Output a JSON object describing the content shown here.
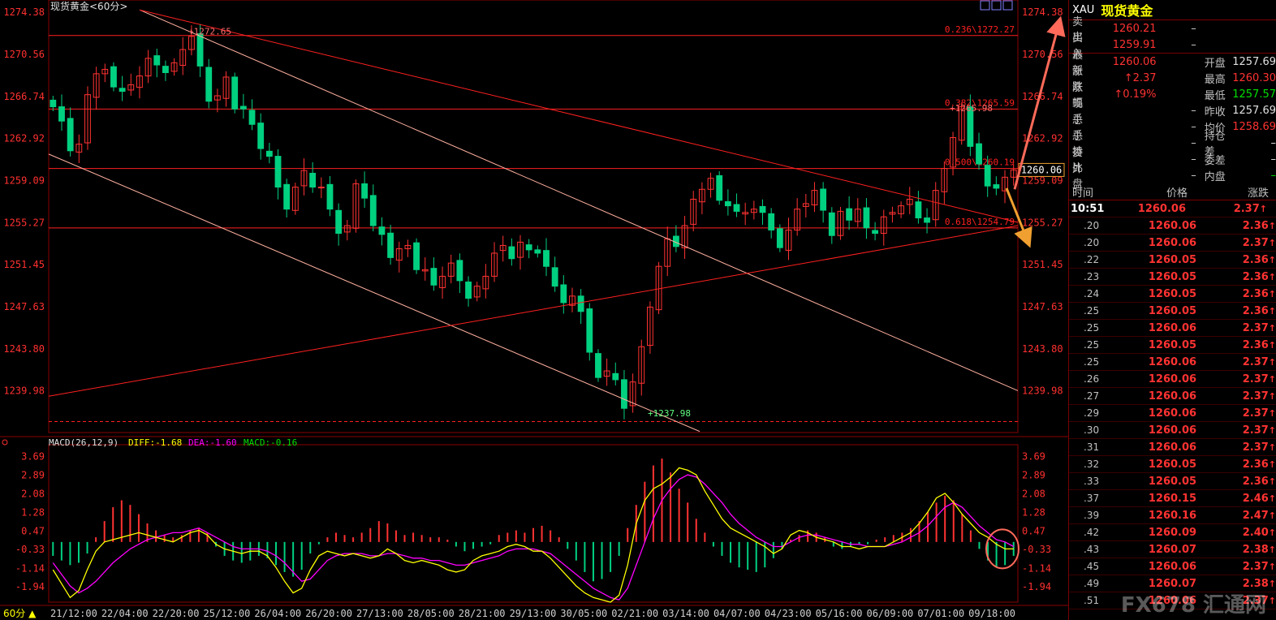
{
  "header": {
    "title": "现货黄金<60分>",
    "macd_label": "MACD(26,12,9)",
    "diff_label": "DIFF:-1.68",
    "dea_label": "DEA:-1.60",
    "macd_value_label": "MACD:-0.16",
    "period_label": "60分"
  },
  "colors": {
    "up": "#ff3232",
    "down": "#00d080",
    "diff": "#ffff00",
    "dea": "#ff00ff",
    "grid": "#8b0000",
    "fib": "#ff2020",
    "arrow_up": "#ff6a5a",
    "arrow_down": "#f0a030"
  },
  "chart_data": {
    "type": "candlestick",
    "price_axis_labels": [
      "1274.38",
      "1270.56",
      "1266.74",
      "1262.92",
      "1259.09",
      "1255.27",
      "1251.45",
      "1247.63",
      "1243.80",
      "1239.98"
    ],
    "price_axis_values": [
      1274.38,
      1270.56,
      1266.74,
      1262.92,
      1259.09,
      1255.27,
      1251.45,
      1247.63,
      1243.8,
      1239.98
    ],
    "ylim": [
      1236.2,
      1275.5
    ],
    "current_price_label": "1260.06",
    "current_price": 1260.06,
    "high_label": "1272.65",
    "high_value": 1272.65,
    "low_label": "1237.98",
    "low_value": 1237.98,
    "local_high_label": "1265.98",
    "fib_levels": [
      {
        "label": "0.236\\1272.27",
        "value": 1272.27
      },
      {
        "label": "0.382\\1265.59",
        "value": 1265.59
      },
      {
        "label": "0.500\\1260.19",
        "value": 1260.19
      },
      {
        "label": "0.618\\1254.79",
        "value": 1254.79
      }
    ],
    "time_labels": [
      "21/12:00",
      "22/04:00",
      "22/20:00",
      "25/12:00",
      "26/04:00",
      "26/20:00",
      "27/13:00",
      "28/05:00",
      "28/21:00",
      "29/13:00",
      "30/05:00",
      "02/21:00",
      "03/14:00",
      "04/07:00",
      "04/23:00",
      "05/16:00",
      "06/09:00",
      "07/01:00",
      "09/18:00"
    ],
    "close_path": [
      1265.8,
      1264.5,
      1261.8,
      1262.4,
      1266.9,
      1268.8,
      1269.2,
      1267.6,
      1267.2,
      1267.8,
      1268.6,
      1270.2,
      1269.6,
      1268.9,
      1269.8,
      1271.0,
      1272.2,
      1269.5,
      1266.3,
      1266.8,
      1268.5,
      1265.6,
      1265.6,
      1264.2,
      1262.0,
      1261.3,
      1258.5,
      1256.5,
      1258.5,
      1260.0,
      1258.5,
      1258.5,
      1256.5,
      1254.3,
      1255.0,
      1258.8,
      1257.5,
      1255.0,
      1254.2,
      1252.1,
      1252.9,
      1253.2,
      1251.0,
      1251.0,
      1249.6,
      1250.4,
      1251.6,
      1250.0,
      1248.4,
      1249.5,
      1250.4,
      1252.5,
      1253.2,
      1252.0,
      1253.5,
      1252.8,
      1252.5,
      1251.3,
      1249.5,
      1248.0,
      1248.6,
      1247.2,
      1243.5,
      1241.2,
      1241.8,
      1241.0,
      1238.4,
      1240.8,
      1244.0,
      1247.6,
      1251.3,
      1253.8,
      1253.1,
      1255.0,
      1257.4,
      1258.3,
      1259.3,
      1257.3,
      1256.8,
      1256.3,
      1256.2,
      1256.5,
      1256.2,
      1254.6,
      1253.0,
      1254.6,
      1256.5,
      1257.0,
      1258.2,
      1256.4,
      1254.1,
      1256.3,
      1255.5,
      1256.5,
      1254.8,
      1254.3,
      1255.8,
      1256.2,
      1256.8,
      1257.4,
      1255.7,
      1255.3,
      1258.2,
      1260.2,
      1263.0,
      1265.8,
      1262.2,
      1260.6,
      1258.6,
      1258.4,
      1259.4,
      1260.06
    ],
    "macd_axis_labels": [
      "3.69",
      "2.89",
      "2.08",
      "1.28",
      "0.47",
      "-0.33",
      "-1.14",
      "-1.94"
    ],
    "macd_axis_values": [
      3.69,
      2.89,
      2.08,
      1.28,
      0.47,
      -0.33,
      -1.14,
      -1.94
    ],
    "macd_ylim": [
      -2.6,
      4.2
    ],
    "macd_hist": [
      -0.6,
      -0.8,
      -1.0,
      -0.9,
      -0.5,
      0.2,
      0.9,
      1.5,
      1.8,
      1.6,
      1.2,
      0.8,
      0.5,
      0.3,
      0.2,
      0.3,
      0.5,
      0.6,
      0.4,
      -0.2,
      -0.6,
      -0.8,
      -0.9,
      -0.8,
      -0.6,
      -0.7,
      -1.0,
      -1.3,
      -1.5,
      -1.2,
      -0.5,
      -0.1,
      0.2,
      0.4,
      0.3,
      0.2,
      0.4,
      0.6,
      0.9,
      0.8,
      0.5,
      0.3,
      0.4,
      0.3,
      0.2,
      0.2,
      0.1,
      -0.2,
      -0.4,
      -0.3,
      -0.2,
      -0.1,
      0.3,
      0.4,
      0.5,
      0.4,
      0.6,
      0.7,
      0.5,
      0.2,
      -0.3,
      -0.8,
      -1.3,
      -1.7,
      -1.6,
      -1.3,
      -0.6,
      0.6,
      1.6,
      2.6,
      3.3,
      3.6,
      3.0,
      2.3,
      1.7,
      1.0,
      0.4,
      -0.2,
      -0.6,
      -0.9,
      -1.1,
      -1.2,
      -1.3,
      -1.1,
      -0.7,
      -0.3,
      0.1,
      0.3,
      0.5,
      0.4,
      0.2,
      -0.2,
      -0.3,
      -0.2,
      -0.1,
      -0.1,
      0.1,
      0.2,
      0.3,
      0.4,
      0.6,
      0.9,
      1.3,
      1.7,
      2.0,
      1.8,
      1.2,
      0.5,
      -0.3,
      -0.8,
      -1.1,
      -1.0,
      -0.6
    ],
    "diff_path": [
      -1.2,
      -1.8,
      -2.4,
      -2.1,
      -1.2,
      -0.4,
      0.0,
      0.1,
      0.2,
      0.3,
      0.4,
      0.3,
      0.2,
      0.1,
      0.0,
      0.2,
      0.4,
      0.5,
      0.3,
      -0.1,
      -0.3,
      -0.4,
      -0.5,
      -0.4,
      -0.4,
      -0.6,
      -1.1,
      -1.7,
      -2.2,
      -2.0,
      -1.2,
      -0.6,
      -0.4,
      -0.5,
      -0.6,
      -0.5,
      -0.6,
      -0.7,
      -0.6,
      -0.3,
      -0.5,
      -0.8,
      -0.9,
      -0.8,
      -0.9,
      -1.0,
      -1.2,
      -1.3,
      -1.2,
      -0.8,
      -0.6,
      -0.5,
      -0.4,
      -0.2,
      -0.1,
      -0.2,
      -0.4,
      -0.4,
      -0.7,
      -1.1,
      -1.5,
      -1.9,
      -2.2,
      -2.4,
      -2.5,
      -2.6,
      -2.3,
      -1.0,
      0.8,
      1.8,
      2.3,
      2.5,
      2.8,
      3.2,
      3.1,
      2.9,
      2.2,
      1.6,
      1.0,
      0.6,
      0.4,
      0.2,
      0.0,
      -0.2,
      -0.5,
      -0.3,
      0.3,
      0.5,
      0.4,
      0.2,
      0.1,
      0.0,
      -0.2,
      -0.2,
      -0.3,
      -0.2,
      -0.2,
      -0.2,
      0.0,
      0.2,
      0.4,
      0.8,
      1.3,
      1.9,
      2.1,
      1.7,
      1.2,
      0.8,
      0.4,
      0.2,
      -0.1,
      -0.3,
      -0.3
    ],
    "dea_path": [
      -0.9,
      -1.4,
      -1.9,
      -2.2,
      -2.0,
      -1.7,
      -1.3,
      -0.9,
      -0.6,
      -0.3,
      -0.1,
      0.1,
      0.2,
      0.3,
      0.4,
      0.4,
      0.5,
      0.6,
      0.4,
      0.2,
      0.0,
      -0.2,
      -0.3,
      -0.3,
      -0.3,
      -0.4,
      -0.6,
      -0.9,
      -1.3,
      -1.7,
      -1.6,
      -1.2,
      -0.8,
      -0.6,
      -0.5,
      -0.5,
      -0.5,
      -0.6,
      -0.6,
      -0.5,
      -0.5,
      -0.6,
      -0.7,
      -0.7,
      -0.8,
      -0.8,
      -0.9,
      -1.0,
      -1.0,
      -0.9,
      -0.8,
      -0.7,
      -0.6,
      -0.4,
      -0.3,
      -0.3,
      -0.3,
      -0.4,
      -0.5,
      -0.8,
      -1.1,
      -1.4,
      -1.7,
      -2.0,
      -2.2,
      -2.4,
      -2.5,
      -2.0,
      -1.0,
      0.0,
      1.0,
      1.8,
      2.3,
      2.7,
      2.9,
      2.8,
      2.5,
      2.1,
      1.7,
      1.2,
      0.8,
      0.5,
      0.2,
      0.0,
      -0.2,
      -0.2,
      0.0,
      0.2,
      0.3,
      0.3,
      0.2,
      0.1,
      0.0,
      -0.1,
      -0.1,
      -0.2,
      -0.2,
      -0.2,
      -0.1,
      0.0,
      0.2,
      0.4,
      0.7,
      1.1,
      1.5,
      1.7,
      1.5,
      1.1,
      0.7,
      0.4,
      0.1,
      0.0,
      -0.2
    ]
  },
  "side_panel": {
    "code": "XAU",
    "name": "现货黄金",
    "quote_rows": [
      {
        "label": "卖出",
        "v1": "1260.21",
        "v1_color": "red",
        "d": "–",
        "label2": "",
        "v2": "",
        "v2_color": "white"
      },
      {
        "label": "买入",
        "v1": "1259.91",
        "v1_color": "red",
        "d": "–",
        "label2": "",
        "v2": "",
        "v2_color": "white"
      },
      {
        "label": "最新",
        "v1": "1260.06",
        "v1_color": "red",
        "d": "",
        "label2": "开盘",
        "v2": "1257.69",
        "v2_color": "white"
      },
      {
        "label": "涨跌",
        "v1": "↑2.37",
        "v1_color": "red",
        "d": "",
        "label2": "最高",
        "v2": "1260.30",
        "v2_color": "red"
      },
      {
        "label": "涨幅",
        "v1": "↑0.19%",
        "v1_color": "red",
        "d": "",
        "label2": "最低",
        "v2": "1257.57",
        "v2_color": "green"
      },
      {
        "label": "现手",
        "v1": "",
        "v1_color": "white",
        "d": "–",
        "label2": "昨收",
        "v2": "1257.69",
        "v2_color": "white"
      },
      {
        "label": "总手",
        "v1": "",
        "v1_color": "white",
        "d": "–",
        "label2": "均价",
        "v2": "1258.69",
        "v2_color": "red"
      },
      {
        "label": "总持",
        "v1": "",
        "v1_color": "white",
        "d": "–",
        "label2": "持仓差",
        "v2": "–",
        "v2_color": "white"
      },
      {
        "label": "委比",
        "v1": "",
        "v1_color": "white",
        "d": "–",
        "label2": "委差",
        "v2": "–",
        "v2_color": "white"
      },
      {
        "label": "外盘",
        "v1": "",
        "v1_color": "red",
        "d": "–",
        "label2": "内盘",
        "v2": "–",
        "v2_color": "green"
      }
    ],
    "ticks_header": {
      "time": "时间",
      "price": "价格",
      "change": "涨跌"
    },
    "ticks": [
      {
        "t": "10:51",
        "p": "1260.06",
        "c": "2.37"
      },
      {
        "t": ".20",
        "p": "1260.06",
        "c": "2.36"
      },
      {
        "t": ".20",
        "p": "1260.06",
        "c": "2.37"
      },
      {
        "t": ".22",
        "p": "1260.05",
        "c": "2.36"
      },
      {
        "t": ".23",
        "p": "1260.05",
        "c": "2.36"
      },
      {
        "t": ".24",
        "p": "1260.05",
        "c": "2.36"
      },
      {
        "t": ".25",
        "p": "1260.05",
        "c": "2.36"
      },
      {
        "t": ".25",
        "p": "1260.06",
        "c": "2.37"
      },
      {
        "t": ".25",
        "p": "1260.05",
        "c": "2.36"
      },
      {
        "t": ".25",
        "p": "1260.06",
        "c": "2.37"
      },
      {
        "t": ".26",
        "p": "1260.06",
        "c": "2.37"
      },
      {
        "t": ".27",
        "p": "1260.06",
        "c": "2.37"
      },
      {
        "t": ".29",
        "p": "1260.06",
        "c": "2.37"
      },
      {
        "t": ".30",
        "p": "1260.06",
        "c": "2.37"
      },
      {
        "t": ".31",
        "p": "1260.06",
        "c": "2.37"
      },
      {
        "t": ".32",
        "p": "1260.05",
        "c": "2.36"
      },
      {
        "t": ".33",
        "p": "1260.05",
        "c": "2.36"
      },
      {
        "t": ".37",
        "p": "1260.15",
        "c": "2.46"
      },
      {
        "t": ".39",
        "p": "1260.16",
        "c": "2.47"
      },
      {
        "t": ".42",
        "p": "1260.09",
        "c": "2.40"
      },
      {
        "t": ".43",
        "p": "1260.07",
        "c": "2.38"
      },
      {
        "t": ".45",
        "p": "1260.06",
        "c": "2.37"
      },
      {
        "t": ".49",
        "p": "1260.07",
        "c": "2.38"
      },
      {
        "t": ".51",
        "p": "1260.06",
        "c": "2.37"
      }
    ],
    "watermark": "FX678 汇通网"
  }
}
